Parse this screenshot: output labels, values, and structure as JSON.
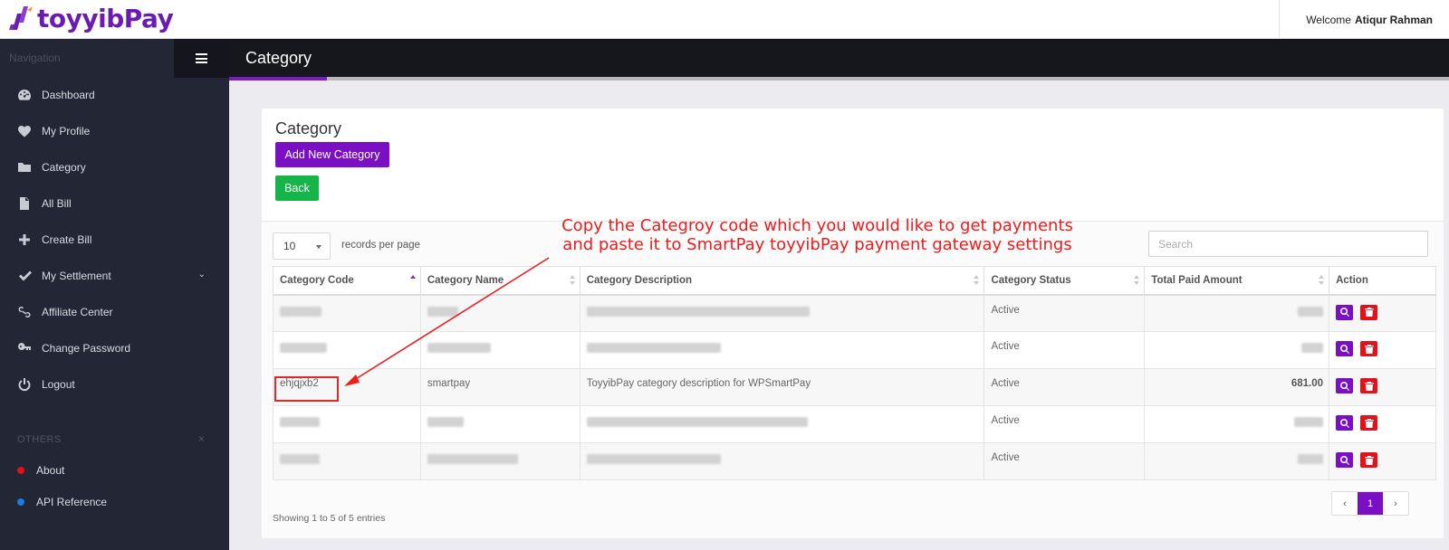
{
  "brand": {
    "name": "toyyibPay",
    "color": "#6a1bb5"
  },
  "header": {
    "welcome_prefix": "Welcome",
    "user_name": "Atiqur Rahman"
  },
  "sidebar": {
    "nav_title": "Navigation",
    "items": [
      {
        "label": "Dashboard",
        "icon": "dashboard-icon"
      },
      {
        "label": "My Profile",
        "icon": "heart-icon"
      },
      {
        "label": "Category",
        "icon": "folder-icon"
      },
      {
        "label": "All Bill",
        "icon": "file-icon"
      },
      {
        "label": "Create Bill",
        "icon": "plus-icon"
      },
      {
        "label": "My Settlement",
        "icon": "check-icon",
        "has_submenu": true
      },
      {
        "label": "Affiliate Center",
        "icon": "link-icon"
      },
      {
        "label": "Change Password",
        "icon": "key-icon"
      },
      {
        "label": "Logout",
        "icon": "power-icon"
      }
    ],
    "others_title": "OTHERS",
    "others_close": "×",
    "others": [
      {
        "label": "About",
        "color": "#e0121c"
      },
      {
        "label": "API Reference",
        "color": "#1a7be0"
      }
    ]
  },
  "page": {
    "title": "Category"
  },
  "card": {
    "title": "Category",
    "add_button": "Add New Category",
    "back_button": "Back",
    "length_value": "10",
    "length_label": "records per page",
    "search_placeholder": "Search"
  },
  "table": {
    "columns": [
      "Category Code",
      "Category Name",
      "Category Description",
      "Category Status",
      "Total Paid Amount",
      "Action"
    ],
    "rows": [
      {
        "code": "",
        "name": "",
        "description": "",
        "status": "Active",
        "amount": "",
        "redacted": true
      },
      {
        "code": "",
        "name": "",
        "description": "",
        "status": "Active",
        "amount": "",
        "redacted": true
      },
      {
        "code": "ehjqjxb2",
        "name": "smartpay",
        "description": "ToyyibPay category description for WPSmartPay",
        "status": "Active",
        "amount": "681.00",
        "redacted": false
      },
      {
        "code": "",
        "name": "",
        "description": "",
        "status": "Active",
        "amount": "",
        "redacted": true
      },
      {
        "code": "",
        "name": "",
        "description": "",
        "status": "Active",
        "amount": "",
        "redacted": true
      }
    ],
    "info": "Showing 1 to 5 of 5 entries",
    "pager": {
      "prev": "‹",
      "current": "1",
      "next": "›"
    }
  },
  "annotation": {
    "line1": "Copy the Categroy code which you would like to get payments",
    "line2": "and paste it to SmartPay toyyibPay payment gateway settings",
    "color": "#ee1c1c"
  }
}
